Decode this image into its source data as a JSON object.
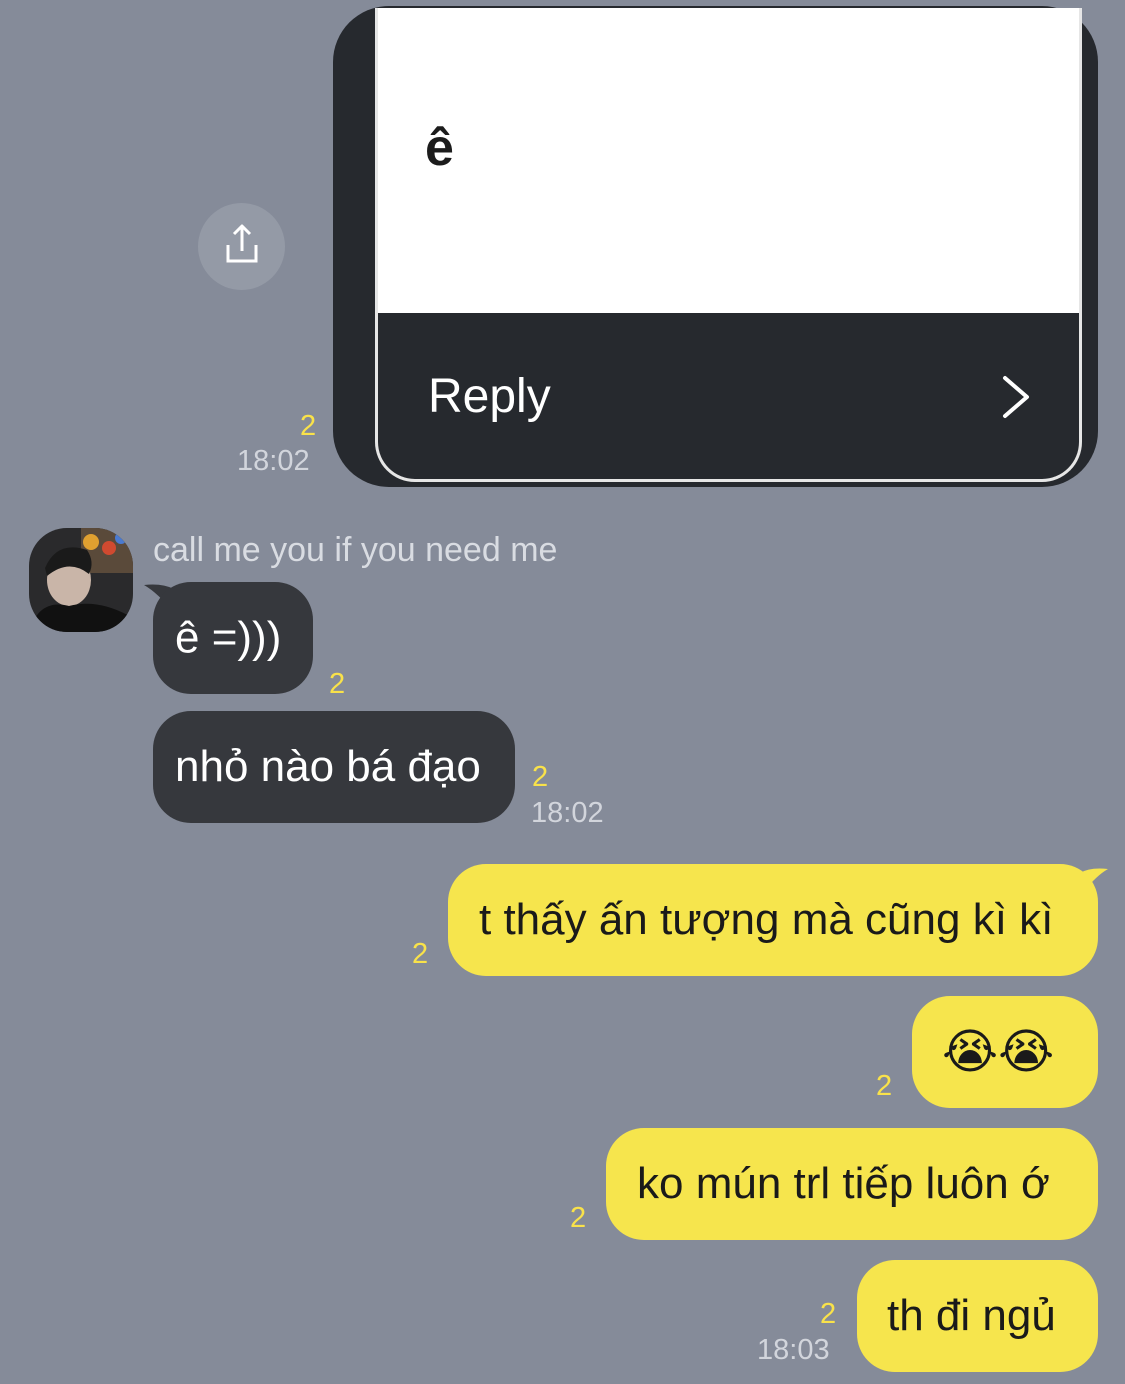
{
  "shared_card": {
    "text": "ê",
    "reply_label": "Reply",
    "unread": "2",
    "time": "18:02"
  },
  "sender": {
    "name": "call me you if you need me"
  },
  "messages": [
    {
      "text": "ê =)))",
      "unread": "2",
      "time": ""
    },
    {
      "text": "nhỏ nào bá đạo",
      "unread": "2",
      "time": "18:02"
    },
    {
      "text": "t thấy ấn tượng mà cũng kì kì",
      "unread": "2",
      "time": ""
    },
    {
      "text": "😭😭",
      "unread": "2",
      "time": ""
    },
    {
      "text": "ko mún trl tiếp luôn ớ",
      "unread": "2",
      "time": ""
    },
    {
      "text": "th đi ngủ",
      "unread": "2",
      "time": "18:03"
    }
  ],
  "colors": {
    "background": "#858b99",
    "incoming_bubble": "#36383d",
    "outgoing_bubble": "#f6e54d",
    "unread_count": "#f9e24a"
  },
  "icons": {
    "share": "share-icon",
    "reply_arrow": "chevron-right-icon"
  }
}
